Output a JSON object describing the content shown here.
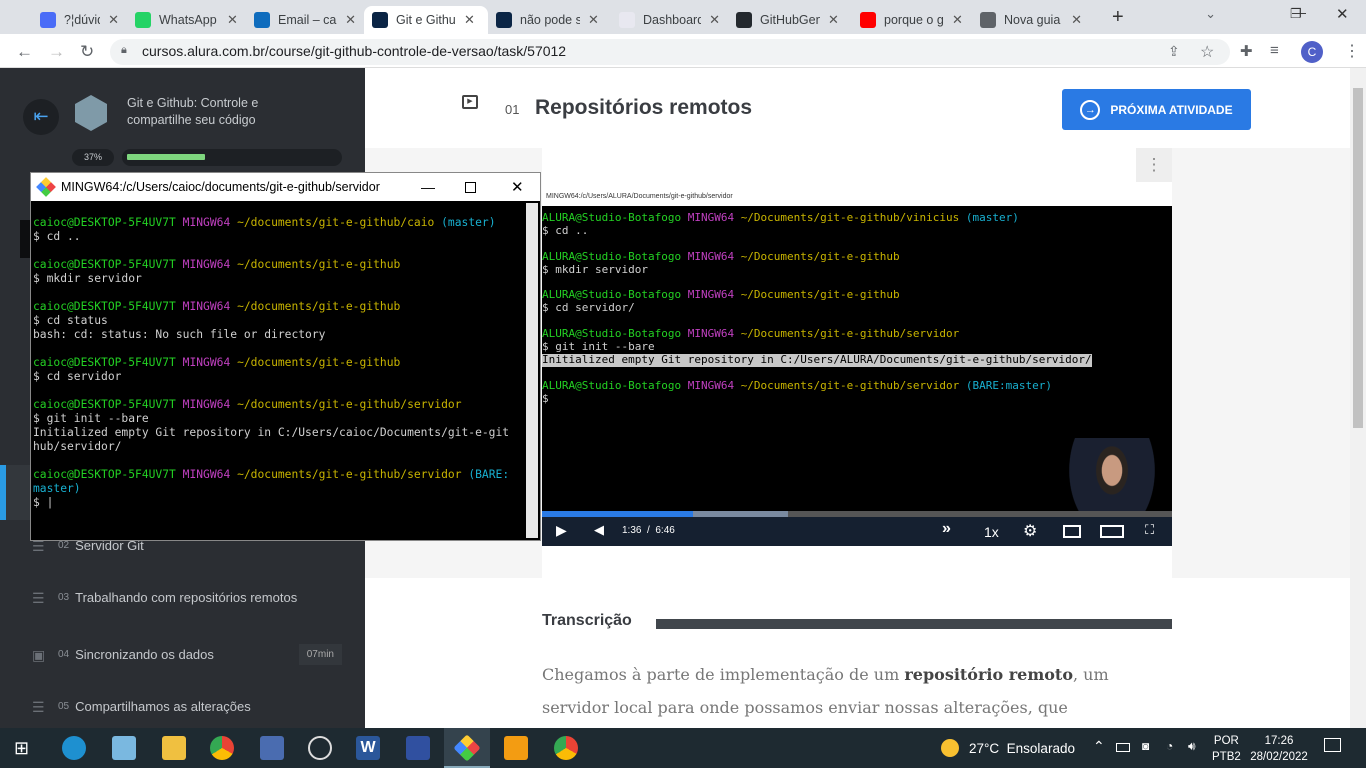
{
  "browser": {
    "tabs": [
      {
        "label": "?¦dúvidas",
        "color": "#4a6cf7"
      },
      {
        "label": "WhatsApp",
        "color": "#25d366"
      },
      {
        "label": "Email – caioc",
        "color": "#0f6cbd"
      },
      {
        "label": "Git e Github",
        "color": "#0b2545",
        "active": true
      },
      {
        "label": "não pode ser",
        "color": "#0b2545"
      },
      {
        "label": "Dashboard",
        "color": "#e8e8f0"
      },
      {
        "label": "GitHubGen",
        "color": "#24292e"
      },
      {
        "label": "porque o git",
        "color": "#ff0000"
      },
      {
        "label": "Nova guia",
        "color": "#5f6368"
      }
    ],
    "new_tab": "+",
    "url": "cursos.alura.com.br/course/git-github-controle-de-versao/task/57012",
    "profile_initial": "C"
  },
  "sidebar": {
    "course_title": "Git e Github: Controle e compartilhe seu código",
    "progress_label": "37%",
    "progress": 0.37,
    "items": [
      {
        "num": "02",
        "label": "Servidor Git",
        "icon": "list-icon"
      },
      {
        "num": "03",
        "label": "Trabalhando com repositórios remotos",
        "icon": "list-icon"
      },
      {
        "num": "04",
        "label": "Sincronizando os dados",
        "icon": "video-icon",
        "badge": "07min"
      },
      {
        "num": "05",
        "label": "Compartilhamos as alterações",
        "icon": "list-icon"
      }
    ]
  },
  "main": {
    "activity_num": "01",
    "title": "Repositórios remotos",
    "next_button": "PRÓXIMA ATIVIDADE",
    "video": {
      "window_title": "MINGW64:/c/Users/ALURA/Documents/git-e-github/servidor",
      "time": "1:36  /  6:46",
      "speed": "1x",
      "played": 0.24,
      "buffered": 0.39,
      "terminal": [
        [
          [
            "g",
            "ALURA@Studio-Botafogo "
          ],
          [
            "m",
            "MINGW64 "
          ],
          [
            "y",
            "~/Documents/git-e-github/vinicius "
          ],
          [
            "c",
            "(master)"
          ]
        ],
        [
          [
            "w",
            "$ cd .."
          ]
        ],
        [
          [
            "w",
            ""
          ]
        ],
        [
          [
            "g",
            "ALURA@Studio-Botafogo "
          ],
          [
            "m",
            "MINGW64 "
          ],
          [
            "y",
            "~/Documents/git-e-github"
          ]
        ],
        [
          [
            "w",
            "$ mkdir servidor"
          ]
        ],
        [
          [
            "w",
            ""
          ]
        ],
        [
          [
            "g",
            "ALURA@Studio-Botafogo "
          ],
          [
            "m",
            "MINGW64 "
          ],
          [
            "y",
            "~/Documents/git-e-github"
          ]
        ],
        [
          [
            "w",
            "$ cd servidor/"
          ]
        ],
        [
          [
            "w",
            ""
          ]
        ],
        [
          [
            "g",
            "ALURA@Studio-Botafogo "
          ],
          [
            "m",
            "MINGW64 "
          ],
          [
            "y",
            "~/Documents/git-e-github/servidor"
          ]
        ],
        [
          [
            "w",
            "$ git init --bare"
          ]
        ],
        [
          [
            "w",
            "Initialized empty Git repository in C:/Users/ALURA/Documents/git-e-github/servidor/"
          ]
        ],
        [
          [
            "w",
            ""
          ]
        ],
        [
          [
            "g",
            "ALURA@Studio-Botafogo "
          ],
          [
            "m",
            "MINGW64 "
          ],
          [
            "y",
            "~/Documents/git-e-github/servidor "
          ],
          [
            "c",
            "(BARE:master)"
          ]
        ],
        [
          [
            "w",
            "$"
          ]
        ]
      ]
    },
    "transcript_heading": "Transcrição",
    "transcript": [
      "Chegamos à parte de implementação de um ",
      "repositório remoto",
      ", um",
      "servidor local para onde possamos enviar nossas alterações, que"
    ]
  },
  "bash_window": {
    "title": "MINGW64:/c/Users/caioc/documents/git-e-github/servidor",
    "terminal": [
      [
        [
          "g",
          "caioc@DESKTOP-5F4UV7T "
        ],
        [
          "m",
          "MINGW64 "
        ],
        [
          "y",
          "~/documents/git-e-github/caio "
        ],
        [
          "c",
          "(master)"
        ]
      ],
      [
        [
          "w",
          "$ cd .."
        ]
      ],
      [
        [
          "w",
          ""
        ]
      ],
      [
        [
          "g",
          "caioc@DESKTOP-5F4UV7T "
        ],
        [
          "m",
          "MINGW64 "
        ],
        [
          "y",
          "~/documents/git-e-github"
        ]
      ],
      [
        [
          "w",
          "$ mkdir servidor"
        ]
      ],
      [
        [
          "w",
          ""
        ]
      ],
      [
        [
          "g",
          "caioc@DESKTOP-5F4UV7T "
        ],
        [
          "m",
          "MINGW64 "
        ],
        [
          "y",
          "~/documents/git-e-github"
        ]
      ],
      [
        [
          "w",
          "$ cd status"
        ]
      ],
      [
        [
          "w",
          "bash: cd: status: No such file or directory"
        ]
      ],
      [
        [
          "w",
          ""
        ]
      ],
      [
        [
          "g",
          "caioc@DESKTOP-5F4UV7T "
        ],
        [
          "m",
          "MINGW64 "
        ],
        [
          "y",
          "~/documents/git-e-github"
        ]
      ],
      [
        [
          "w",
          "$ cd servidor"
        ]
      ],
      [
        [
          "w",
          ""
        ]
      ],
      [
        [
          "g",
          "caioc@DESKTOP-5F4UV7T "
        ],
        [
          "m",
          "MINGW64 "
        ],
        [
          "y",
          "~/documents/git-e-github/servidor"
        ]
      ],
      [
        [
          "w",
          "$ git init --bare"
        ]
      ],
      [
        [
          "w",
          "Initialized empty Git repository in C:/Users/caioc/Documents/git-e-git"
        ]
      ],
      [
        [
          "w",
          "hub/servidor/"
        ]
      ],
      [
        [
          "w",
          ""
        ]
      ],
      [
        [
          "g",
          "caioc@DESKTOP-5F4UV7T "
        ],
        [
          "m",
          "MINGW64 "
        ],
        [
          "y",
          "~/documents/git-e-github/servidor "
        ],
        [
          "c",
          "(BARE:"
        ]
      ],
      [
        [
          "c",
          "master)"
        ]
      ],
      [
        [
          "w",
          "$ |"
        ]
      ]
    ]
  },
  "taskbar": {
    "weather": "27°C  Ensolarado",
    "lang1": "POR",
    "lang2": "PTB2",
    "time": "17:26",
    "date": "28/02/2022"
  }
}
